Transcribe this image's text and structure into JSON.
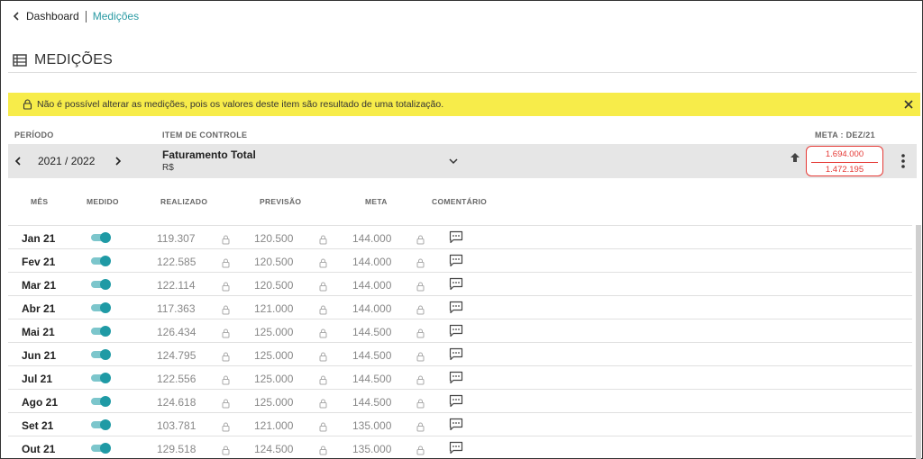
{
  "breadcrumb": {
    "back_label": "Dashboard",
    "current": "Medições"
  },
  "page_title": "MEDIÇÕES",
  "alert": {
    "message": "Não é possível alterar as medições, pois os valores deste item são resultado de uma totalização."
  },
  "labels": {
    "period": "PERÍODO",
    "item": "ITEM DE CONTROLE",
    "meta": "META : DEZ/21"
  },
  "period": {
    "value": "2021 / 2022"
  },
  "item": {
    "name": "Faturamento Total",
    "unit": "R$"
  },
  "meta_values": {
    "top": "1.694.000",
    "bottom": "1.472.195"
  },
  "colors": {
    "accent": "#1f9aa5",
    "alert_bg": "#f7ec4a",
    "danger": "#e53935"
  },
  "table": {
    "headers": {
      "month": "MÊS",
      "measured": "MEDIDO",
      "realized": "REALIZADO",
      "forecast": "PREVISÃO",
      "target": "META",
      "comment": "COMENTÁRIO"
    },
    "rows": [
      {
        "month": "Jan 21",
        "measured": true,
        "realized": "119.307",
        "forecast": "120.500",
        "target": "144.000"
      },
      {
        "month": "Fev 21",
        "measured": true,
        "realized": "122.585",
        "forecast": "120.500",
        "target": "144.000"
      },
      {
        "month": "Mar 21",
        "measured": true,
        "realized": "122.114",
        "forecast": "120.500",
        "target": "144.000"
      },
      {
        "month": "Abr 21",
        "measured": true,
        "realized": "117.363",
        "forecast": "121.000",
        "target": "144.000"
      },
      {
        "month": "Mai 21",
        "measured": true,
        "realized": "126.434",
        "forecast": "125.000",
        "target": "144.500"
      },
      {
        "month": "Jun 21",
        "measured": true,
        "realized": "124.795",
        "forecast": "125.000",
        "target": "144.500"
      },
      {
        "month": "Jul 21",
        "measured": true,
        "realized": "122.556",
        "forecast": "125.000",
        "target": "144.500"
      },
      {
        "month": "Ago 21",
        "measured": true,
        "realized": "124.618",
        "forecast": "125.000",
        "target": "144.500"
      },
      {
        "month": "Set 21",
        "measured": true,
        "realized": "103.781",
        "forecast": "121.000",
        "target": "135.000"
      },
      {
        "month": "Out 21",
        "measured": true,
        "realized": "129.518",
        "forecast": "124.500",
        "target": "135.000"
      }
    ]
  }
}
